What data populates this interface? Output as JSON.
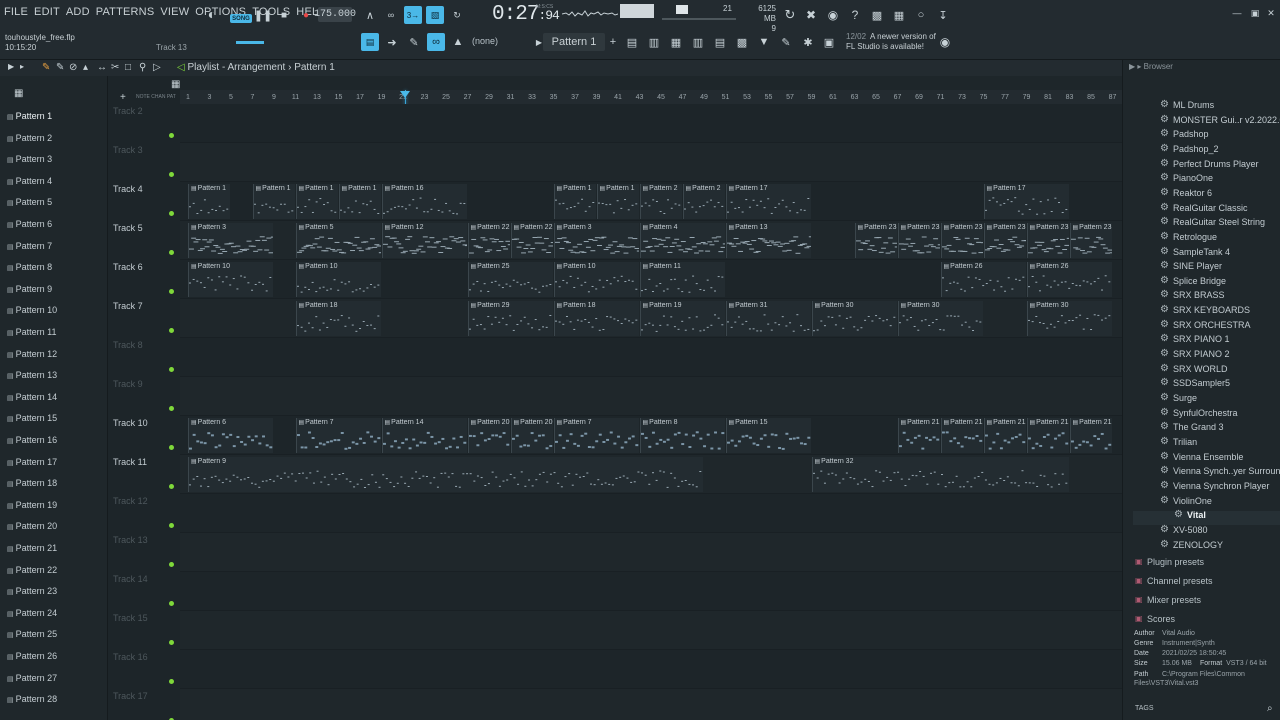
{
  "menu": [
    "FILE",
    "EDIT",
    "ADD",
    "PATTERNS",
    "VIEW",
    "OPTIONS",
    "TOOLS",
    "HELP"
  ],
  "transport": {
    "mode": "SONG",
    "tempo": "175.000",
    "time_main": "0:27",
    "time_sub": ":94",
    "time_label": "M:S:CS"
  },
  "project": {
    "file": "touhoustyle_free.flp",
    "clock": "10:15:20",
    "hint_track": "Track 13"
  },
  "system": {
    "memory": "6125 MB",
    "voices": "9",
    "cpu": "21"
  },
  "news": {
    "date": "12/02",
    "line1": "A newer version of",
    "line2": "FL Studio is available!"
  },
  "toolbar": {
    "pattern_selector": "Pattern 1",
    "snap": "(none)"
  },
  "playlist": {
    "title": "Playlist - Arrangement",
    "crumb": "Pattern 1"
  },
  "patterns": [
    "Pattern 1",
    "Pattern 2",
    "Pattern 3",
    "Pattern 4",
    "Pattern 5",
    "Pattern 6",
    "Pattern 7",
    "Pattern 8",
    "Pattern 9",
    "Pattern 10",
    "Pattern 11",
    "Pattern 12",
    "Pattern 13",
    "Pattern 14",
    "Pattern 15",
    "Pattern 16",
    "Pattern 17",
    "Pattern 18",
    "Pattern 19",
    "Pattern 20",
    "Pattern 21",
    "Pattern 22",
    "Pattern 23",
    "Pattern 24",
    "Pattern 25",
    "Pattern 26",
    "Pattern 27",
    "Pattern 28"
  ],
  "ruler": [
    "1",
    "3",
    "5",
    "7",
    "9",
    "11",
    "13",
    "15",
    "17",
    "19",
    "21",
    "23",
    "25",
    "27",
    "29",
    "31",
    "33",
    "35",
    "37",
    "39",
    "41",
    "43",
    "45",
    "47",
    "49",
    "51",
    "53",
    "55",
    "57",
    "59",
    "61",
    "63",
    "65",
    "67",
    "69",
    "71",
    "73",
    "75",
    "77",
    "79",
    "81",
    "83",
    "85",
    "87"
  ],
  "tracks": [
    {
      "name": "Track 2",
      "active": false
    },
    {
      "name": "Track 3",
      "active": false
    },
    {
      "name": "Track 4",
      "active": true
    },
    {
      "name": "Track 5",
      "active": true
    },
    {
      "name": "Track 6",
      "active": true
    },
    {
      "name": "Track 7",
      "active": true
    },
    {
      "name": "Track 8",
      "active": false
    },
    {
      "name": "Track 9",
      "active": false
    },
    {
      "name": "Track 10",
      "active": true
    },
    {
      "name": "Track 11",
      "active": true
    },
    {
      "name": "Track 12",
      "active": false
    },
    {
      "name": "Track 13",
      "active": false
    },
    {
      "name": "Track 14",
      "active": false
    },
    {
      "name": "Track 15",
      "active": false
    },
    {
      "name": "Track 16",
      "active": false
    },
    {
      "name": "Track 17",
      "active": false
    }
  ],
  "clips": [
    {
      "lane": 2,
      "bar": 1,
      "len": 4,
      "label": "Pattern 1"
    },
    {
      "lane": 2,
      "bar": 7,
      "len": 4,
      "label": "Pattern 1"
    },
    {
      "lane": 2,
      "bar": 11,
      "len": 4,
      "label": "Pattern 1"
    },
    {
      "lane": 2,
      "bar": 15,
      "len": 4,
      "label": "Pattern 1"
    },
    {
      "lane": 2,
      "bar": 19,
      "len": 8,
      "label": "Pattern 16"
    },
    {
      "lane": 2,
      "bar": 35,
      "len": 4,
      "label": "Pattern 1"
    },
    {
      "lane": 2,
      "bar": 39,
      "len": 4,
      "label": "Pattern 1"
    },
    {
      "lane": 2,
      "bar": 43,
      "len": 4,
      "label": "Pattern 2"
    },
    {
      "lane": 2,
      "bar": 47,
      "len": 4,
      "label": "Pattern 2"
    },
    {
      "lane": 2,
      "bar": 51,
      "len": 8,
      "label": "Pattern 17"
    },
    {
      "lane": 2,
      "bar": 75,
      "len": 8,
      "label": "Pattern 17"
    },
    {
      "lane": 3,
      "bar": 1,
      "len": 8,
      "label": "Pattern 3"
    },
    {
      "lane": 3,
      "bar": 11,
      "len": 8,
      "label": "Pattern 5"
    },
    {
      "lane": 3,
      "bar": 19,
      "len": 8,
      "label": "Pattern 12"
    },
    {
      "lane": 3,
      "bar": 27,
      "len": 4,
      "label": "Pattern 22"
    },
    {
      "lane": 3,
      "bar": 31,
      "len": 4,
      "label": "Pattern 22"
    },
    {
      "lane": 3,
      "bar": 35,
      "len": 8,
      "label": "Pattern 3"
    },
    {
      "lane": 3,
      "bar": 43,
      "len": 8,
      "label": "Pattern 4"
    },
    {
      "lane": 3,
      "bar": 51,
      "len": 8,
      "label": "Pattern 13"
    },
    {
      "lane": 3,
      "bar": 63,
      "len": 4,
      "label": "Pattern 23"
    },
    {
      "lane": 3,
      "bar": 67,
      "len": 4,
      "label": "Pattern 23"
    },
    {
      "lane": 3,
      "bar": 71,
      "len": 4,
      "label": "Pattern 23"
    },
    {
      "lane": 3,
      "bar": 75,
      "len": 4,
      "label": "Pattern 23"
    },
    {
      "lane": 3,
      "bar": 79,
      "len": 4,
      "label": "Pattern 23"
    },
    {
      "lane": 3,
      "bar": 83,
      "len": 4,
      "label": "Pattern 23"
    },
    {
      "lane": 4,
      "bar": 1,
      "len": 8,
      "label": "Pattern 10"
    },
    {
      "lane": 4,
      "bar": 11,
      "len": 8,
      "label": "Pattern 10"
    },
    {
      "lane": 4,
      "bar": 27,
      "len": 8,
      "label": "Pattern 25"
    },
    {
      "lane": 4,
      "bar": 35,
      "len": 8,
      "label": "Pattern 10"
    },
    {
      "lane": 4,
      "bar": 43,
      "len": 8,
      "label": "Pattern 11"
    },
    {
      "lane": 4,
      "bar": 71,
      "len": 8,
      "label": "Pattern 26"
    },
    {
      "lane": 4,
      "bar": 79,
      "len": 8,
      "label": "Pattern 26"
    },
    {
      "lane": 5,
      "bar": 11,
      "len": 8,
      "label": "Pattern 18"
    },
    {
      "lane": 5,
      "bar": 27,
      "len": 8,
      "label": "Pattern 29"
    },
    {
      "lane": 5,
      "bar": 35,
      "len": 8,
      "label": "Pattern 18"
    },
    {
      "lane": 5,
      "bar": 43,
      "len": 8,
      "label": "Pattern 19"
    },
    {
      "lane": 5,
      "bar": 51,
      "len": 8,
      "label": "Pattern 31"
    },
    {
      "lane": 5,
      "bar": 59,
      "len": 8,
      "label": "Pattern 30"
    },
    {
      "lane": 5,
      "bar": 67,
      "len": 8,
      "label": "Pattern 30"
    },
    {
      "lane": 5,
      "bar": 79,
      "len": 8,
      "label": "Pattern 30"
    },
    {
      "lane": 8,
      "bar": 1,
      "len": 8,
      "label": "Pattern 6"
    },
    {
      "lane": 8,
      "bar": 11,
      "len": 8,
      "label": "Pattern 7"
    },
    {
      "lane": 8,
      "bar": 19,
      "len": 8,
      "label": "Pattern 14"
    },
    {
      "lane": 8,
      "bar": 27,
      "len": 4,
      "label": "Pattern 20"
    },
    {
      "lane": 8,
      "bar": 31,
      "len": 4,
      "label": "Pattern 20"
    },
    {
      "lane": 8,
      "bar": 35,
      "len": 8,
      "label": "Pattern 7"
    },
    {
      "lane": 8,
      "bar": 43,
      "len": 8,
      "label": "Pattern 8"
    },
    {
      "lane": 8,
      "bar": 51,
      "len": 8,
      "label": "Pattern 15"
    },
    {
      "lane": 8,
      "bar": 67,
      "len": 4,
      "label": "Pattern 21"
    },
    {
      "lane": 8,
      "bar": 71,
      "len": 4,
      "label": "Pattern 21"
    },
    {
      "lane": 8,
      "bar": 75,
      "len": 4,
      "label": "Pattern 21"
    },
    {
      "lane": 8,
      "bar": 79,
      "len": 4,
      "label": "Pattern 21"
    },
    {
      "lane": 8,
      "bar": 83,
      "len": 4,
      "label": "Pattern 21"
    },
    {
      "lane": 9,
      "bar": 1,
      "len": 48,
      "label": "Pattern 9"
    },
    {
      "lane": 9,
      "bar": 59,
      "len": 24,
      "label": "Pattern 32"
    }
  ],
  "browser": {
    "title": "Browser",
    "plugins": [
      "ML Drums",
      "MONSTER Gui..r v2.2022.09",
      "Padshop",
      "Padshop_2",
      "Perfect Drums Player",
      "PianoOne",
      "Reaktor 6",
      "RealGuitar Classic",
      "RealGuitar Steel String",
      "Retrologue",
      "SampleTank 4",
      "SINE Player",
      "Splice Bridge",
      "SRX BRASS",
      "SRX KEYBOARDS",
      "SRX ORCHESTRA",
      "SRX PIANO 1",
      "SRX PIANO 2",
      "SRX WORLD",
      "SSDSampler5",
      "Surge",
      "SynfulOrchestra",
      "The Grand 3",
      "Trilian",
      "Vienna Ensemble",
      "Vienna Synch..yer Surround",
      "Vienna Synchron Player",
      "ViolinOne",
      "Vital",
      "XV-5080",
      "ZENOLOGY"
    ],
    "selected": "Vital",
    "sections": [
      "Plugin presets",
      "Channel presets",
      "Mixer presets",
      "Scores"
    ],
    "meta": [
      {
        "k": "Author",
        "v": "Vital Audio"
      },
      {
        "k": "Genre",
        "v": "Instrument|Synth"
      },
      {
        "k": "Date",
        "v": "2021/02/25 18:50:45"
      },
      {
        "k": "Size",
        "v": "15.06 MB"
      },
      {
        "k": "Path",
        "v": "C:\\Program Files\\Common Files\\VST3\\Vital.vst3"
      }
    ],
    "format_label": "Format",
    "format_value": "VST3 / 64 bit",
    "tags_label": "TAGS"
  },
  "colors": {
    "accent": "#4ab8e8",
    "led": "#7fd83a",
    "playhead": "#39a6d8"
  }
}
